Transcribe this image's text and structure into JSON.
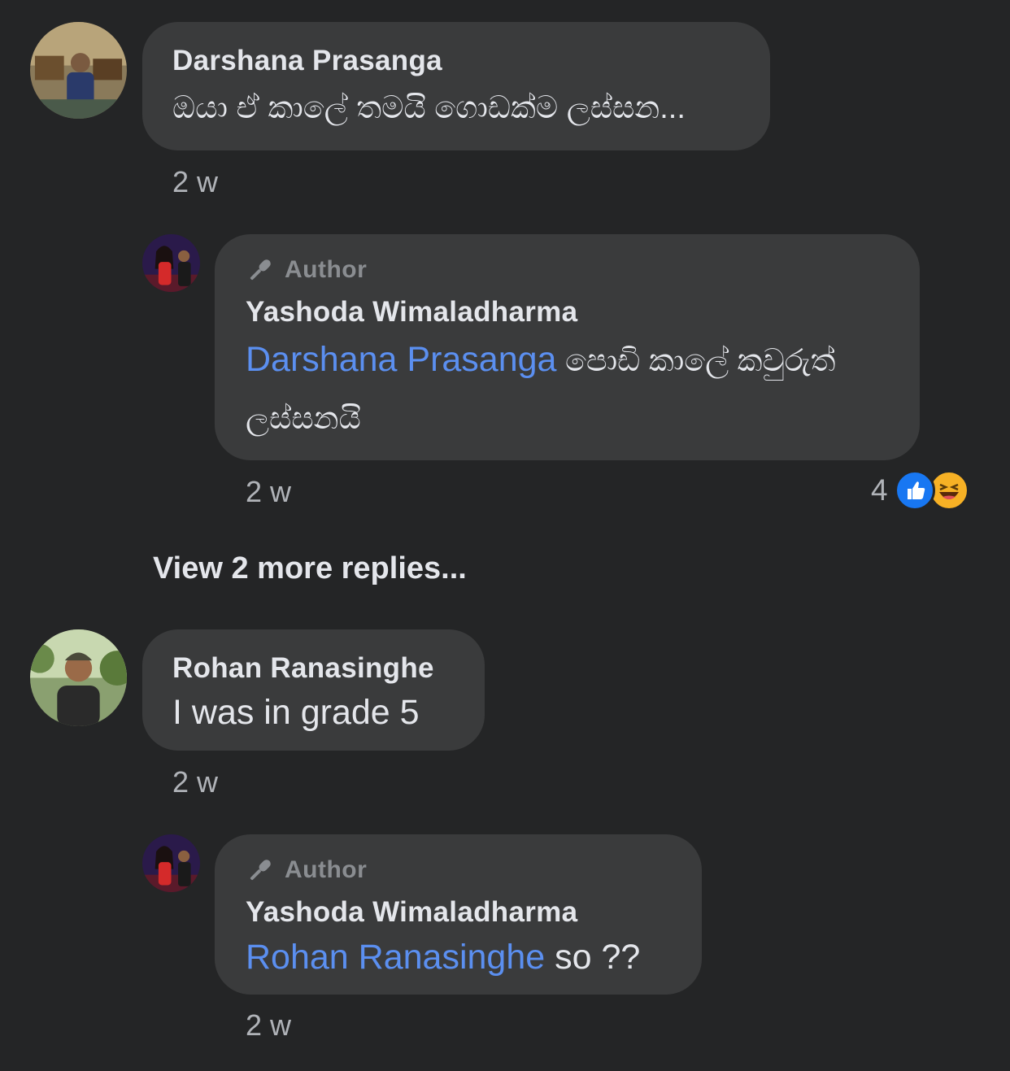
{
  "comments": [
    {
      "name": "Darshana Prasanga",
      "text": "ඔයා ඒ කාලේ තමයි ගොඩක්ම ලස්සන...",
      "time": "2 w",
      "reply": {
        "badge": "Author",
        "name": "Yashoda Wimaladharma",
        "mention": "Darshana Prasanga",
        "text_line1": " පොඩි කාලේ කවුරුත්",
        "text_line2": "ලස්සනයි",
        "time": "2 w",
        "reaction_count": "4",
        "reaction_icons": [
          "like-icon",
          "haha-icon"
        ]
      }
    },
    {
      "name": "Rohan Ranasinghe",
      "text": "I was in grade 5",
      "time": "2 w",
      "reply": {
        "badge": "Author",
        "name": "Yashoda Wimaladharma",
        "mention": "Rohan Ranasinghe",
        "text": " so ??",
        "time": "2 w"
      }
    }
  ],
  "view_more_label": "View 2 more replies...",
  "colors": {
    "background": "#242526",
    "bubble": "#3a3b3c",
    "mention": "#5b8ff0",
    "like": "#1877f2",
    "haha": "#f7b125"
  }
}
